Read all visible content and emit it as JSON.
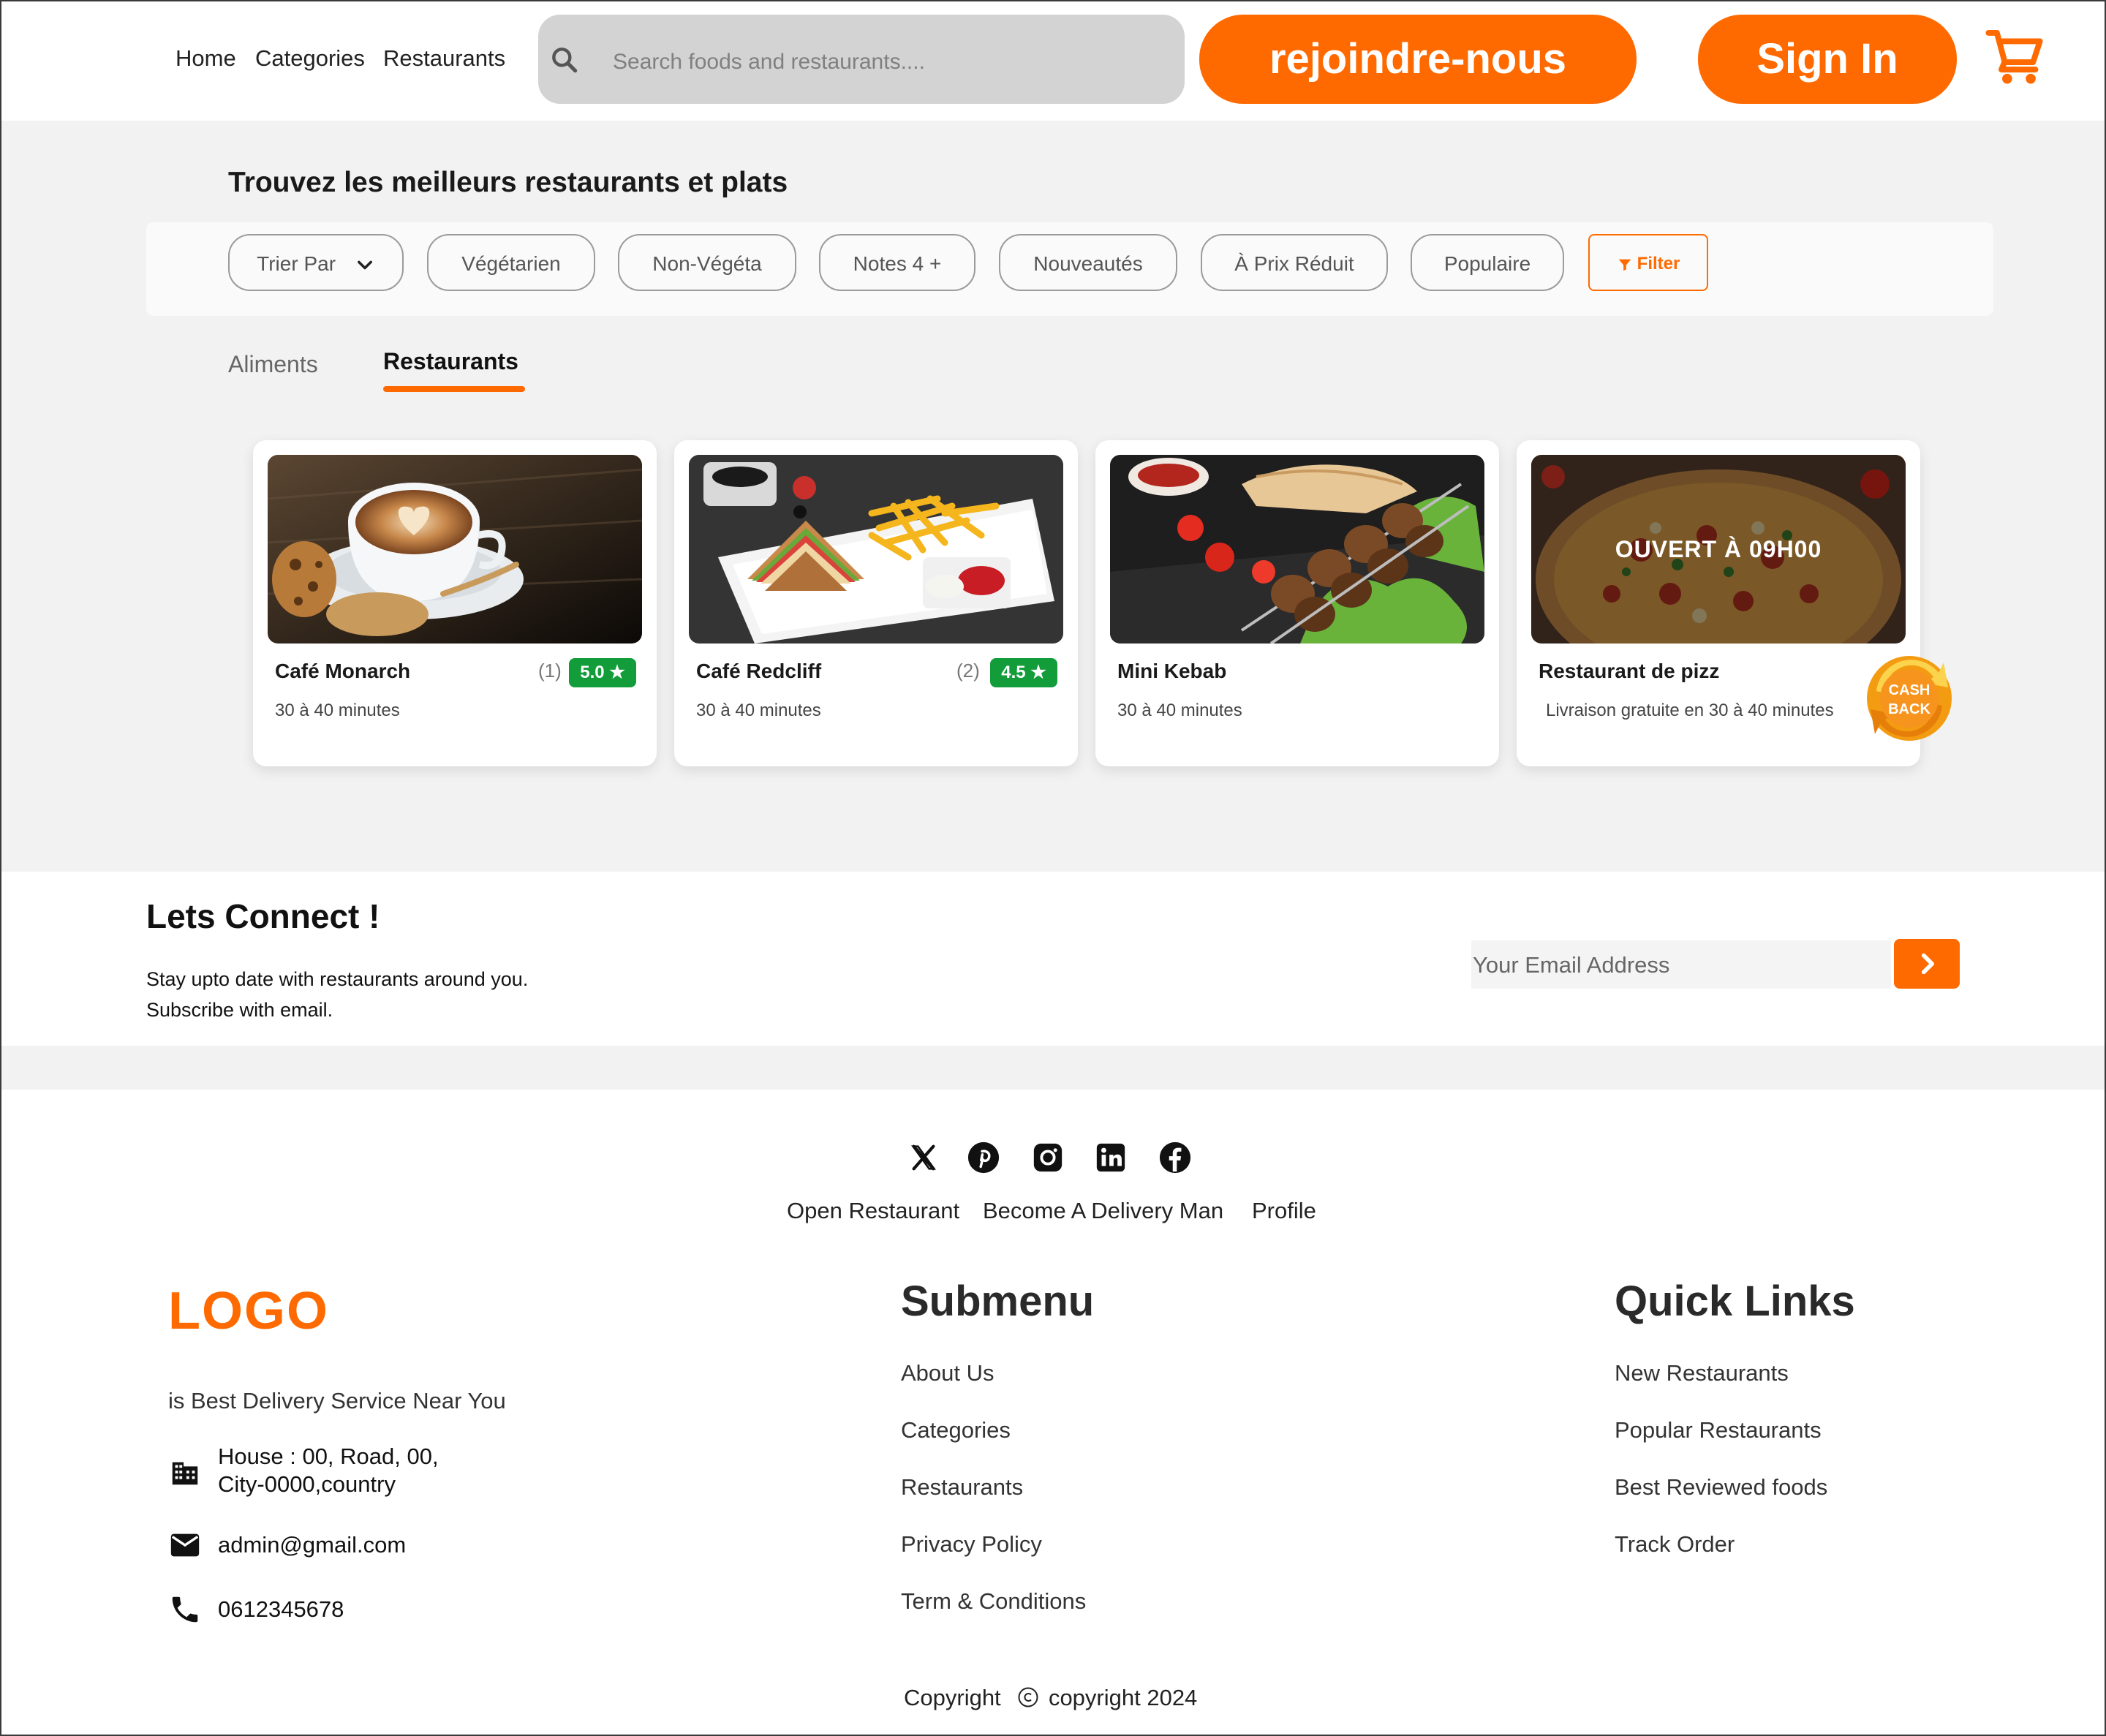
{
  "nav": {
    "items": [
      "Home",
      "Categories",
      "Restaurants"
    ]
  },
  "search": {
    "placeholder": "Search foods and restaurants...."
  },
  "header": {
    "join_label": "rejoindre-nous",
    "signin_label": "Sign In"
  },
  "colors": {
    "accent": "#ff6a00",
    "rating_green": "#129c3a",
    "page_gray": "#f2f2f2"
  },
  "icons": {
    "search": "search-icon",
    "cart": "cart-icon",
    "chevron": "chevron-down-icon",
    "funnel": "funnel-icon"
  },
  "main": {
    "title": "Trouvez les meilleurs restaurants et plats",
    "filters": [
      "Trier Par",
      "Végétarien",
      "Non-Végéta",
      "Notes 4 +",
      "Nouveautés",
      "À Prix Réduit",
      "Populaire"
    ],
    "filter_button": "Filter",
    "tabs": [
      "Aliments",
      "Restaurants"
    ],
    "active_tab": "Restaurants",
    "cards": [
      {
        "name": "Café Monarch",
        "time": "30 à 40 minutes",
        "count": "(1)",
        "rating": "5.0 ★"
      },
      {
        "name": "Café Redcliff",
        "time": "30 à 40 minutes",
        "count": "(2)",
        "rating": "4.5 ★"
      },
      {
        "name": "Mini Kebab",
        "time": "30 à 40 minutes"
      },
      {
        "name": "Restaurant de pizz",
        "time": "Livraison gratuite en 30 à 40 minutes",
        "overlay": "OUVERT À 09H00",
        "badge": "CASH BACK"
      }
    ]
  },
  "connect": {
    "title": "Lets Connect !",
    "line1": "Stay upto date with restaurants around you.",
    "line2": "Subscribe with email.",
    "email_placeholder": "Your Email Address"
  },
  "footer": {
    "social": [
      "x-icon",
      "pinterest-icon",
      "instagram-icon",
      "linkedin-icon",
      "facebook-icon"
    ],
    "links": [
      "Open Restaurant",
      "Become A Delivery Man",
      "Profile"
    ],
    "logo": "LOGO",
    "tagline": "is Best Delivery Service Near You",
    "address_line1": "House : 00, Road, 00,",
    "address_line2": "City-0000,country",
    "email": "admin@gmail.com",
    "phone": "0612345678",
    "submenu_title": "Submenu",
    "submenu": [
      "About Us",
      "Categories",
      "Restaurants",
      "Privacy Policy",
      "Term & Conditions"
    ],
    "quick_title": "Quick Links",
    "quick": [
      "New Restaurants",
      "Popular Restaurants",
      "Best Reviewed foods",
      "Track Order"
    ],
    "copyright_label": "Copyright",
    "copyright_text": "copyright 2024"
  }
}
